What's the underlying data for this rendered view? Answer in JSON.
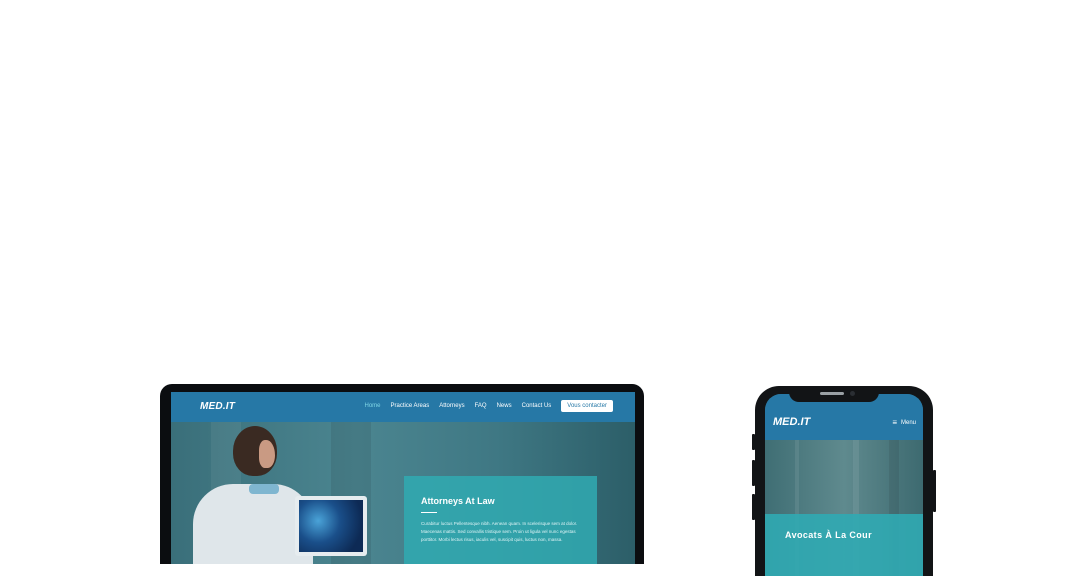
{
  "desktop": {
    "logo": "MED.IT",
    "nav": [
      {
        "label": "Home",
        "active": true
      },
      {
        "label": "Practice Areas",
        "active": false
      },
      {
        "label": "Attorneys",
        "active": false
      },
      {
        "label": "FAQ",
        "active": false
      },
      {
        "label": "News",
        "active": false
      },
      {
        "label": "Contact Us",
        "active": false
      }
    ],
    "cta": "Vous contacter",
    "hero": {
      "title": "Attorneys At Law",
      "body": "Curabitur luctus Pellentesque nibh. Aenean quam. In scelerisque sem at dolor. Maecenas mattis. Sed convallis tristique sem. Proin ut ligula vel nunc egestas porttitor. Morbi lectus risus, iaculis vel, suscipit quis, luctus non, massa."
    }
  },
  "mobile": {
    "logo": "MED.IT",
    "menu_label": "Menu",
    "hero_title": "Avocats À La Cour"
  },
  "colors": {
    "brand_blue": "#2678a6",
    "hero_card_teal": "#30aab2",
    "active_link": "#7fd6e6"
  },
  "icons": {
    "menu": "hamburger-icon"
  }
}
